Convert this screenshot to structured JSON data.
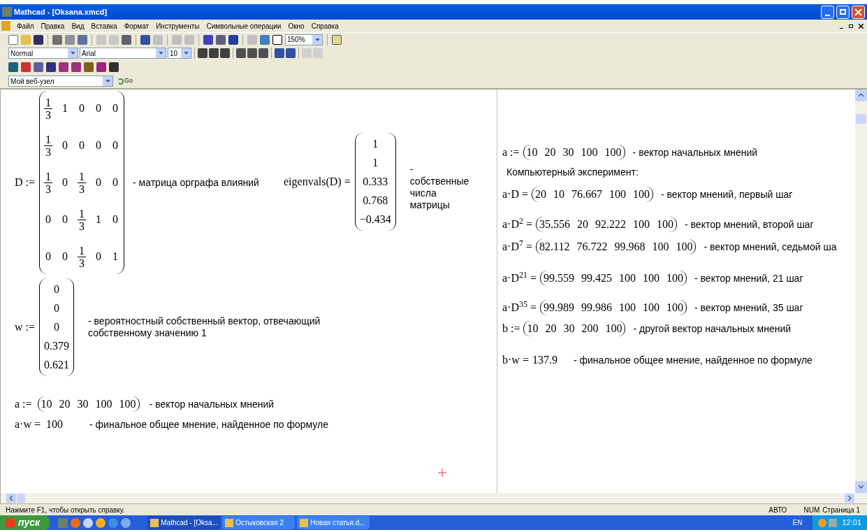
{
  "window": {
    "title": "Mathcad - [Oksana.xmcd]"
  },
  "menu": [
    "Файл",
    "Правка",
    "Вид",
    "Вставка",
    "Формат",
    "Инструменты",
    "Символьные операции",
    "Окно",
    "Справка"
  ],
  "standard_toolbar": {
    "zoom": "150%"
  },
  "formatting_toolbar": {
    "style": "Normal",
    "font": "Arial",
    "size": "10"
  },
  "web_toolbar": {
    "address": "Мой веб-узел",
    "go": "Go"
  },
  "left_page": {
    "matrix": {
      "lhs": "D :=",
      "rows": [
        [
          {
            "num": "1",
            "den": "3"
          },
          "1",
          "0",
          "0",
          "0"
        ],
        [
          {
            "num": "1",
            "den": "3"
          },
          "0",
          "0",
          "0",
          "0"
        ],
        [
          {
            "num": "1",
            "den": "3"
          },
          "0",
          {
            "num": "1",
            "den": "3"
          },
          "0",
          "0"
        ],
        [
          "0",
          "0",
          {
            "num": "1",
            "den": "3"
          },
          "1",
          "0"
        ],
        [
          "0",
          "0",
          {
            "num": "1",
            "den": "3"
          },
          "0",
          "1"
        ]
      ],
      "comment": "- матрица орграфа влияний"
    },
    "eigen": {
      "lhs": "eigenvals(D) =",
      "values": [
        "1",
        "1",
        "0.333",
        "0.768",
        "−0.434"
      ],
      "comment": "- собственные числа матрицы"
    },
    "vector": {
      "lhs": "w :=",
      "values": [
        "0",
        "0",
        "0",
        "0.379",
        "0.621"
      ],
      "comment": "- вероятностный собственный вектор, отвечающий собственному значению 1"
    },
    "lines": [
      {
        "kind": "vector",
        "lhs": "a :=",
        "values": [
          "10",
          "20",
          "30",
          "100",
          "100"
        ],
        "comment": "- вектор начальных мнений"
      },
      {
        "kind": "scalar",
        "lhs": "a·w =",
        "result": "100",
        "comment": "- финальное общее мнение, найденное по формуле"
      }
    ]
  },
  "right_page": {
    "lines": [
      {
        "kind": "vector",
        "lhs": "a :=",
        "values": [
          "10",
          "20",
          "30",
          "100",
          "100"
        ],
        "comment": "- вектор начальных мнений"
      },
      {
        "kind": "text",
        "comment": "Компьютерный эксперимент:"
      },
      {
        "kind": "vector",
        "lhs": "a·D =",
        "values": [
          "20",
          "10",
          "76.667",
          "100",
          "100"
        ],
        "comment": "- вектор мнений, первый шаг"
      },
      {
        "kind": "vector",
        "lhs": "a·D$^{2}$ =",
        "values": [
          "35.556",
          "20",
          "92.222",
          "100",
          "100"
        ],
        "comment": "- вектор мнений, второй шаг"
      },
      {
        "kind": "vector",
        "lhs": "a·D$^{7}$ =",
        "values": [
          "82.112",
          "76.722",
          "99.968",
          "100",
          "100"
        ],
        "comment": "- вектор мнений, седьмой ша"
      },
      {
        "kind": "vector",
        "lhs": "a·D$^{21}$ =",
        "values": [
          "99.559",
          "99.425",
          "100",
          "100",
          "100"
        ],
        "comment": "- вектор мнений, 21 шаг"
      },
      {
        "kind": "vector",
        "lhs": "a·D$^{35}$ =",
        "values": [
          "99.989",
          "99.986",
          "100",
          "100",
          "100"
        ],
        "comment": "- вектор мнений, 35 шаг"
      },
      {
        "kind": "vector",
        "lhs": "b :=",
        "values": [
          "10",
          "20",
          "30",
          "200",
          "100"
        ],
        "comment": "- другой вектор начальных мнений"
      },
      {
        "kind": "scalar",
        "lhs": "b·w =",
        "result": "137.9",
        "comment": "- финальное общее мнение, найденное по формуле"
      }
    ]
  },
  "status_bar": {
    "hint": "Нажмите F1, чтобы открыть справку.",
    "mode": "АВТО",
    "num": "NUM",
    "page": "Страница 1"
  },
  "taskbar": {
    "start": "пуск",
    "tasks": [
      {
        "label": "Mathcad - [Oksa...",
        "selected": true
      },
      {
        "label": "Остыковская 2",
        "selected": false
      },
      {
        "label": "Новая статья.d...",
        "selected": false
      }
    ],
    "language": "EN",
    "clock": "12:01"
  }
}
